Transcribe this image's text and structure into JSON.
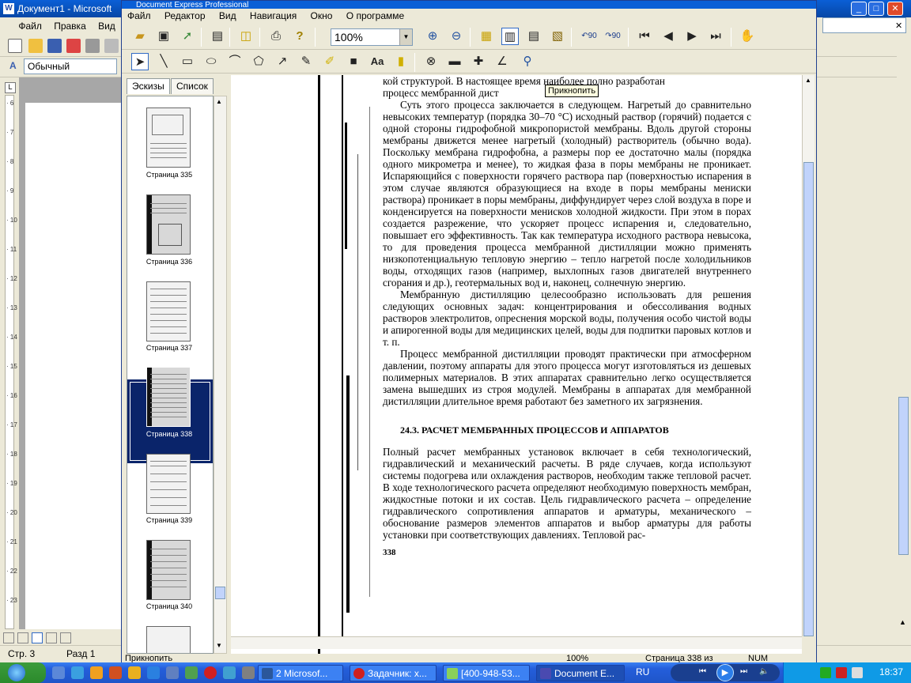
{
  "word": {
    "title": "Документ1 - Microsoft",
    "menu": [
      "Файл",
      "Правка",
      "Вид"
    ],
    "style": "Обычный",
    "ruler_numbers": [
      "6",
      "7",
      "8",
      "9",
      "10",
      "11",
      "12",
      "13",
      "14",
      "15",
      "16",
      "17",
      "18",
      "19",
      "20",
      "21",
      "22",
      "23"
    ],
    "status": {
      "page": "Стр. 3",
      "section": "Разд 1"
    }
  },
  "dx": {
    "title": "Document Express Professional",
    "menu": [
      "Файл",
      "Редактор",
      "Вид",
      "Навигация",
      "Окно",
      "О программе"
    ],
    "zoom": "100%",
    "rotate_left_label": "90",
    "rotate_right_label": "90",
    "tooltip": "Прикнопить",
    "tabs": {
      "thumbs": "Эскизы",
      "list": "Список"
    },
    "thumbnails": [
      {
        "label": "Страница 335"
      },
      {
        "label": "Страница 336"
      },
      {
        "label": "Страница 337"
      },
      {
        "label": "Страница 338"
      },
      {
        "label": "Страница 339"
      },
      {
        "label": "Страница 340"
      }
    ],
    "status": {
      "left": "Прикнопить",
      "zoom": "100%",
      "page": "Страница 338 из",
      "num": "NUM"
    }
  },
  "document": {
    "top_lines": [
      "кой структурой. В настоящее время наиболее полно разработан",
      "процесс мембранной дист"
    ],
    "paragraphs": [
      "Суть этого процесса заключается в следующем. Нагретый до сравнительно невысоких температур (порядка 30–70 °С) исходный раствор (горячий) подается с одной стороны гидрофобной микропористой мембраны. Вдоль другой стороны мембраны движется менее нагретый (холодный) растворитель (обычно вода). Поскольку мембрана гидрофобна, а размеры пор ее достаточно малы (порядка одного микрометра и менее), то жидкая фаза в поры мембраны не проникает. Испаряющийся с поверхности горячего раствора пар (поверхностью испарения в этом случае являются образующиеся на входе в поры мембраны мениски раствора) проникает в поры мембраны, диффундирует через слой воздуха в поре и конденсируется на поверхности менисков холодной жидкости. При этом в порах создается разрежение, что ускоряет процесс испарения и, следовательно, повышает его эффективность. Так как температура исходного раствора невысока, то для проведения процесса мембранной дистилляции можно применять низкопотенциальную тепловую энергию – тепло нагретой после холодильников воды, отходящих газов (например, выхлопных газов двигателей внутреннего сгорания и др.), геотермальных вод и, наконец, солнечную энергию.",
      "Мембранную дистилляцию целесообразно использовать для решения следующих основных задач: концентрирования и обессоливания водных растворов электролитов, опреснения морской воды, получения особо чистой воды и апирогенной воды для медицинских целей, воды для подпитки паровых котлов и т. п.",
      "Процесс мембранной дистилляции проводят практически при атмосферном давлении, поэтому аппараты для этого процесса могут изготовляться из дешевых полимерных материалов. В этих аппаратах сравнительно легко осуществляется замена вышедших из строя модулей. Мембраны в аппаратах для мембранной дистилляции длительное время работают без заметного их загрязнения."
    ],
    "section_heading": "24.3. РАСЧЕТ МЕМБРАННЫХ ПРОЦЕССОВ И АППАРАТОВ",
    "section_paragraph": "Полный расчет мембранных установок включает в себя технологический, гидравлический и механический расчеты. В ряде случаев, когда используют системы подогрева или охлаждения растворов, необходим также тепловой расчет. В ходе технологического расчета определяют необходимую поверхность мембран, жидкостные потоки и их состав. Цель гидравлического расчета – определение гидравлического сопротивления аппаратов и арматуры, механического – обоснование размеров элементов аппаратов и выбор арматуры для работы установки при соответствующих давлениях. Тепловой рас-",
    "page_number": "338"
  },
  "taskbar": {
    "items": [
      "2 Microsof...",
      "Задачник: х...",
      "[400-948-53...",
      "Document E..."
    ],
    "lang": "RU",
    "clock": "18:37"
  }
}
